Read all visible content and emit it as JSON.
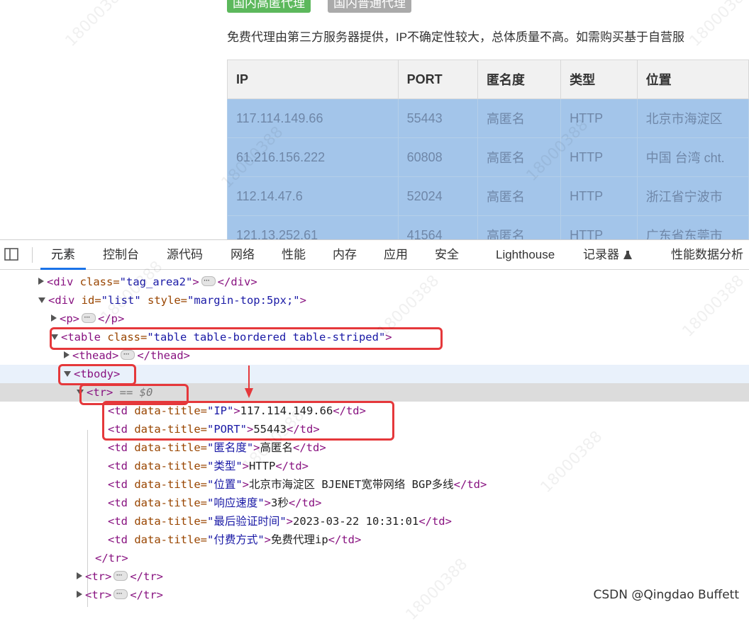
{
  "page": {
    "tags": [
      "国内高匿代理",
      "国内普通代理"
    ],
    "notice": "免费代理由第三方服务器提供，IP不确定性较大，总体质量不高。如需购买基于自营服",
    "table": {
      "headers": [
        "IP",
        "PORT",
        "匿名度",
        "类型",
        "位置"
      ],
      "rows": [
        [
          "117.114.149.66",
          "55443",
          "高匿名",
          "HTTP",
          "北京市海淀区"
        ],
        [
          "61.216.156.222",
          "60808",
          "高匿名",
          "HTTP",
          "中国 台湾 cht."
        ],
        [
          "112.14.47.6",
          "52024",
          "高匿名",
          "HTTP",
          "浙江省宁波市"
        ],
        [
          "121.13.252.61",
          "41564",
          "高匿名",
          "HTTP",
          "广东省东莞市"
        ]
      ]
    }
  },
  "devtools": {
    "tabs": [
      "元素",
      "控制台",
      "源代码",
      "网络",
      "性能",
      "内存",
      "应用",
      "安全",
      "Lighthouse",
      "记录器",
      "性能数据分析"
    ],
    "active_tab": "元素",
    "lines": [
      {
        "open": "<div",
        "attr": " class=",
        "val": "\"tag_area2\"",
        "close1": ">",
        "ell": true,
        "close2": "</div>"
      },
      {
        "open": "<div",
        "attr": " id=",
        "val": "\"list\"",
        "attr2": " style=",
        "val2": "\"margin-top:5px;\"",
        "close1": ">"
      },
      {
        "open": "<p",
        "close1": ">",
        "ell": true,
        "close2": "</p>"
      },
      {
        "open": "<table",
        "attr": " class=",
        "val": "\"table table-bordered table-striped\"",
        "close1": ">"
      },
      {
        "open": "<thead",
        "close1": ">",
        "ell": true,
        "close2": "</thead>"
      },
      {
        "open": "<tbody",
        "close1": ">"
      },
      {
        "open": "<tr",
        "close1": ">",
        "suffix": " == $0"
      },
      {
        "open": "<td",
        "attr": " data-title=",
        "val": "\"IP\"",
        "close1": ">",
        "text": "117.114.149.66",
        "close2": "</td>"
      },
      {
        "open": "<td",
        "attr": " data-title=",
        "val": "\"PORT\"",
        "close1": ">",
        "text": "55443",
        "close2": "</td>"
      },
      {
        "open": "<td",
        "attr": " data-title=",
        "val": "\"匿名度\"",
        "close1": ">",
        "text": "高匿名",
        "close2": "</td>"
      },
      {
        "open": "<td",
        "attr": " data-title=",
        "val": "\"类型\"",
        "close1": ">",
        "text": "HTTP",
        "close2": "</td>"
      },
      {
        "open": "<td",
        "attr": " data-title=",
        "val": "\"位置\"",
        "close1": ">",
        "text": "北京市海淀区 BJENET宽带网络 BGP多线",
        "close2": "</td>"
      },
      {
        "open": "<td",
        "attr": " data-title=",
        "val": "\"响应速度\"",
        "close1": ">",
        "text": "3秒",
        "close2": "</td>"
      },
      {
        "open": "<td",
        "attr": " data-title=",
        "val": "\"最后验证时间\"",
        "close1": ">",
        "text": "2023-03-22 10:31:01",
        "close2": "</td>"
      },
      {
        "open": "<td",
        "attr": " data-title=",
        "val": "\"付费方式\"",
        "close1": ">",
        "text": "免费代理ip",
        "close2": "</td>"
      },
      {
        "close2": "</tr>"
      },
      {
        "open": "<tr",
        "close1": ">",
        "ell": true,
        "close2": "</tr>"
      },
      {
        "open": "<tr",
        "close1": ">",
        "ell": true,
        "close2": "</tr>"
      }
    ]
  },
  "watermark": "18000388",
  "credit": "CSDN @Qingdao Buffett"
}
